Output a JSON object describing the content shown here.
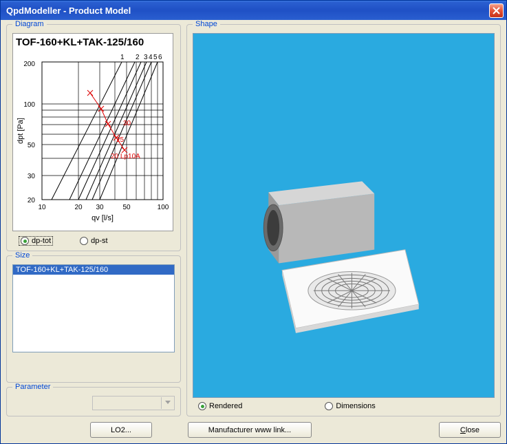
{
  "window": {
    "title": "QpdModeller - Product Model"
  },
  "diagram": {
    "group_label": "Diagram",
    "title": "TOF-160+KL+TAK-125/160",
    "xlabel": "qv [l/s]",
    "ylabel": "dpt [Pa]",
    "radios": {
      "dptot": "dp-tot",
      "dpst": "dp-st"
    }
  },
  "size": {
    "group_label": "Size",
    "items": [
      "TOF-160+KL+TAK-125/160"
    ]
  },
  "parameter": {
    "group_label": "Parameter"
  },
  "shape": {
    "group_label": "Shape",
    "radios": {
      "rendered": "Rendered",
      "dimensions": "Dimensions"
    }
  },
  "buttons": {
    "lo2": "LO2...",
    "mfr": "Manufacturer www link...",
    "close": "Close"
  },
  "chart_data": {
    "type": "line",
    "title": "TOF-160+KL+TAK-125/160",
    "xlabel": "qv [l/s]",
    "ylabel": "dpt [Pa]",
    "x_scale": "log",
    "y_scale": "log",
    "xlim": [
      10,
      100
    ],
    "ylim": [
      20,
      200
    ],
    "x_ticks": [
      10,
      20,
      30,
      50,
      100
    ],
    "y_ticks": [
      20,
      30,
      50,
      100,
      200
    ],
    "series_top_labels": [
      "1",
      "2",
      "3",
      "4",
      "5",
      "6"
    ],
    "annotations": [
      {
        "text": "30",
        "x": 50,
        "y": 80
      },
      {
        "text": "25",
        "x": 42,
        "y": 55
      },
      {
        "text": "20 Lp10A",
        "x": 45,
        "y": 38
      }
    ],
    "series": [
      {
        "name": "1",
        "x": [
          12,
          45
        ],
        "y": [
          20,
          200
        ]
      },
      {
        "name": "2",
        "x": [
          17,
          58
        ],
        "y": [
          20,
          200
        ]
      },
      {
        "name": "3",
        "x": [
          20,
          65
        ],
        "y": [
          20,
          200
        ]
      },
      {
        "name": "4",
        "x": [
          23,
          72
        ],
        "y": [
          20,
          200
        ]
      },
      {
        "name": "5",
        "x": [
          26,
          80
        ],
        "y": [
          20,
          200
        ]
      },
      {
        "name": "6",
        "x": [
          30,
          90
        ],
        "y": [
          20,
          200
        ]
      }
    ],
    "marker_curve": {
      "color": "red",
      "points": [
        {
          "x": 25,
          "y": 135
        },
        {
          "x": 33,
          "y": 100
        },
        {
          "x": 38,
          "y": 75
        },
        {
          "x": 44,
          "y": 55
        },
        {
          "x": 50,
          "y": 42
        }
      ]
    }
  }
}
